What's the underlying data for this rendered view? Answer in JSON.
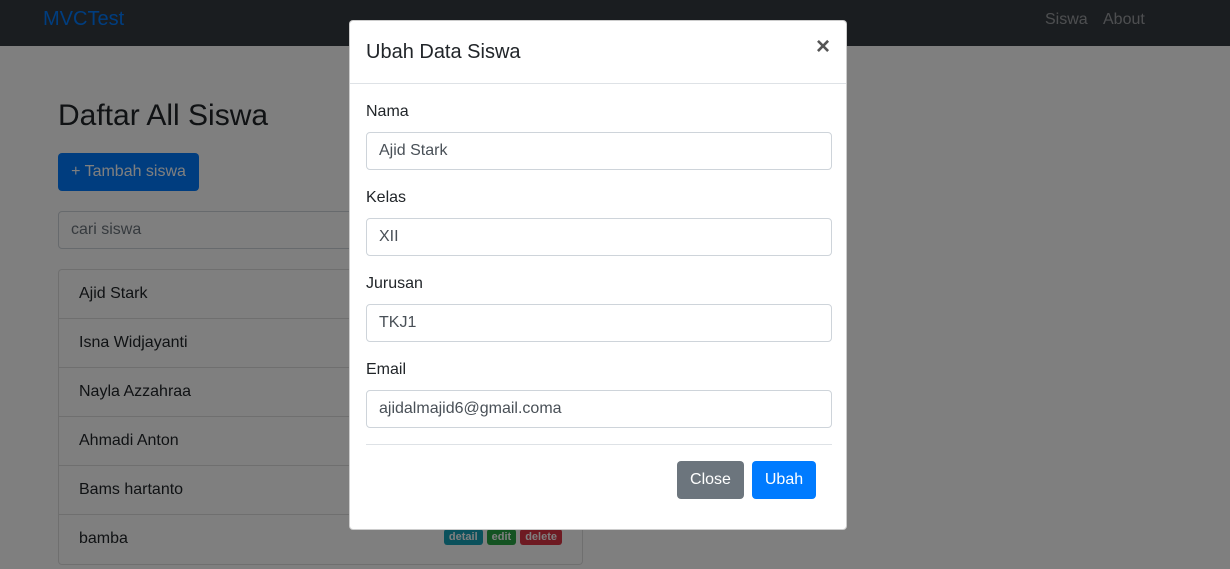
{
  "navbar": {
    "brand": "MVCTest",
    "links": [
      "Siswa",
      "About"
    ]
  },
  "main": {
    "title": "Daftar All Siswa",
    "add_button": "+ Tambah siswa",
    "search_placeholder": "cari siswa",
    "students": [
      "Ajid Stark",
      "Isna Widjayanti",
      "Nayla Azzahraa",
      "Ahmadi Anton",
      "Bams hartanto",
      "bamba"
    ],
    "badges": {
      "detail": "detail",
      "edit": "edit",
      "delete": "delete"
    }
  },
  "modal": {
    "title": "Ubah Data Siswa",
    "close_icon": "×",
    "fields": {
      "nama": {
        "label": "Nama",
        "value": "Ajid Stark"
      },
      "kelas": {
        "label": "Kelas",
        "value": "XII"
      },
      "jurusan": {
        "label": "Jurusan",
        "value": "TKJ1"
      },
      "email": {
        "label": "Email",
        "value": "ajidalmajid6@gmail.coma"
      }
    },
    "close_button": "Close",
    "submit_button": "Ubah"
  }
}
